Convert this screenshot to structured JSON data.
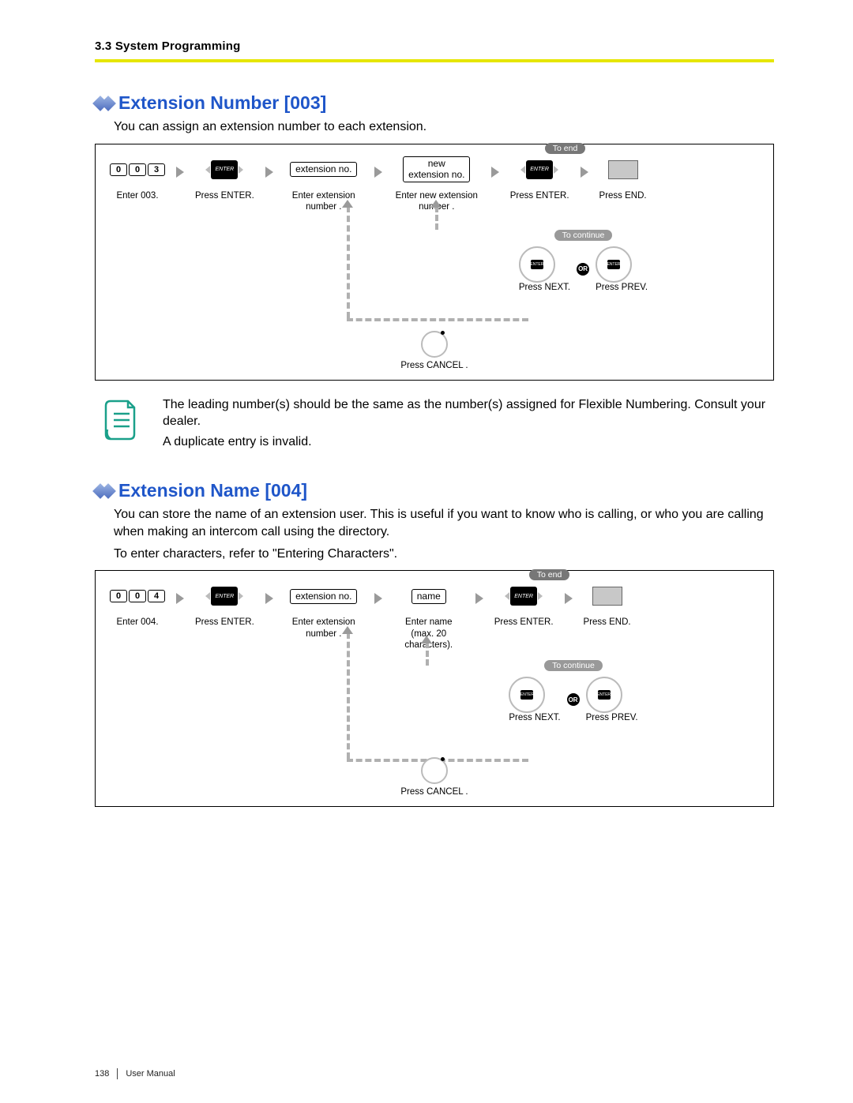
{
  "header": {
    "section_label": "3.3 System Programming"
  },
  "section1": {
    "title": "Extension Number [003]",
    "intro": "You can assign an extension number to each extension.",
    "steps": {
      "enter_code_digits": [
        "0",
        "0",
        "3"
      ],
      "enter_code_label": "Enter 003.",
      "press_enter1": "Press ENTER.",
      "ext_field": "extension no.",
      "ext_label": "Enter extension number  .",
      "new_ext_field_l1": "new",
      "new_ext_field_l2": "extension no.",
      "new_ext_label": "Enter new extension number  .",
      "press_enter2": "Press ENTER.",
      "to_end": "To end",
      "press_end": "Press END.",
      "to_continue": "To continue",
      "press_next": "Press NEXT.",
      "press_prev": "Press PREV.",
      "or": "OR",
      "press_cancel": "Press CANCEL ."
    },
    "note1": "The leading number(s) should be the same as the number(s) assigned for Flexible Numbering. Consult your dealer.",
    "note2": "A duplicate entry is invalid."
  },
  "section2": {
    "title": "Extension Name [004]",
    "intro1": "You can store the name of an extension user. This is useful if you want to know who is calling, or who you are calling when making an intercom call using the directory.",
    "intro2": "To enter characters, refer to \"Entering Characters\".",
    "steps": {
      "enter_code_digits": [
        "0",
        "0",
        "4"
      ],
      "enter_code_label": "Enter 004.",
      "press_enter1": "Press ENTER.",
      "ext_field": "extension no.",
      "ext_label": "Enter extension number  .",
      "name_field": "name",
      "name_label": "Enter name (max. 20 characters).",
      "press_enter2": "Press ENTER.",
      "to_end": "To end",
      "press_end": "Press END.",
      "to_continue": "To continue",
      "press_next": "Press NEXT.",
      "press_prev": "Press PREV.",
      "or": "OR",
      "press_cancel": "Press CANCEL ."
    }
  },
  "footer": {
    "page": "138",
    "doc": "User Manual"
  }
}
